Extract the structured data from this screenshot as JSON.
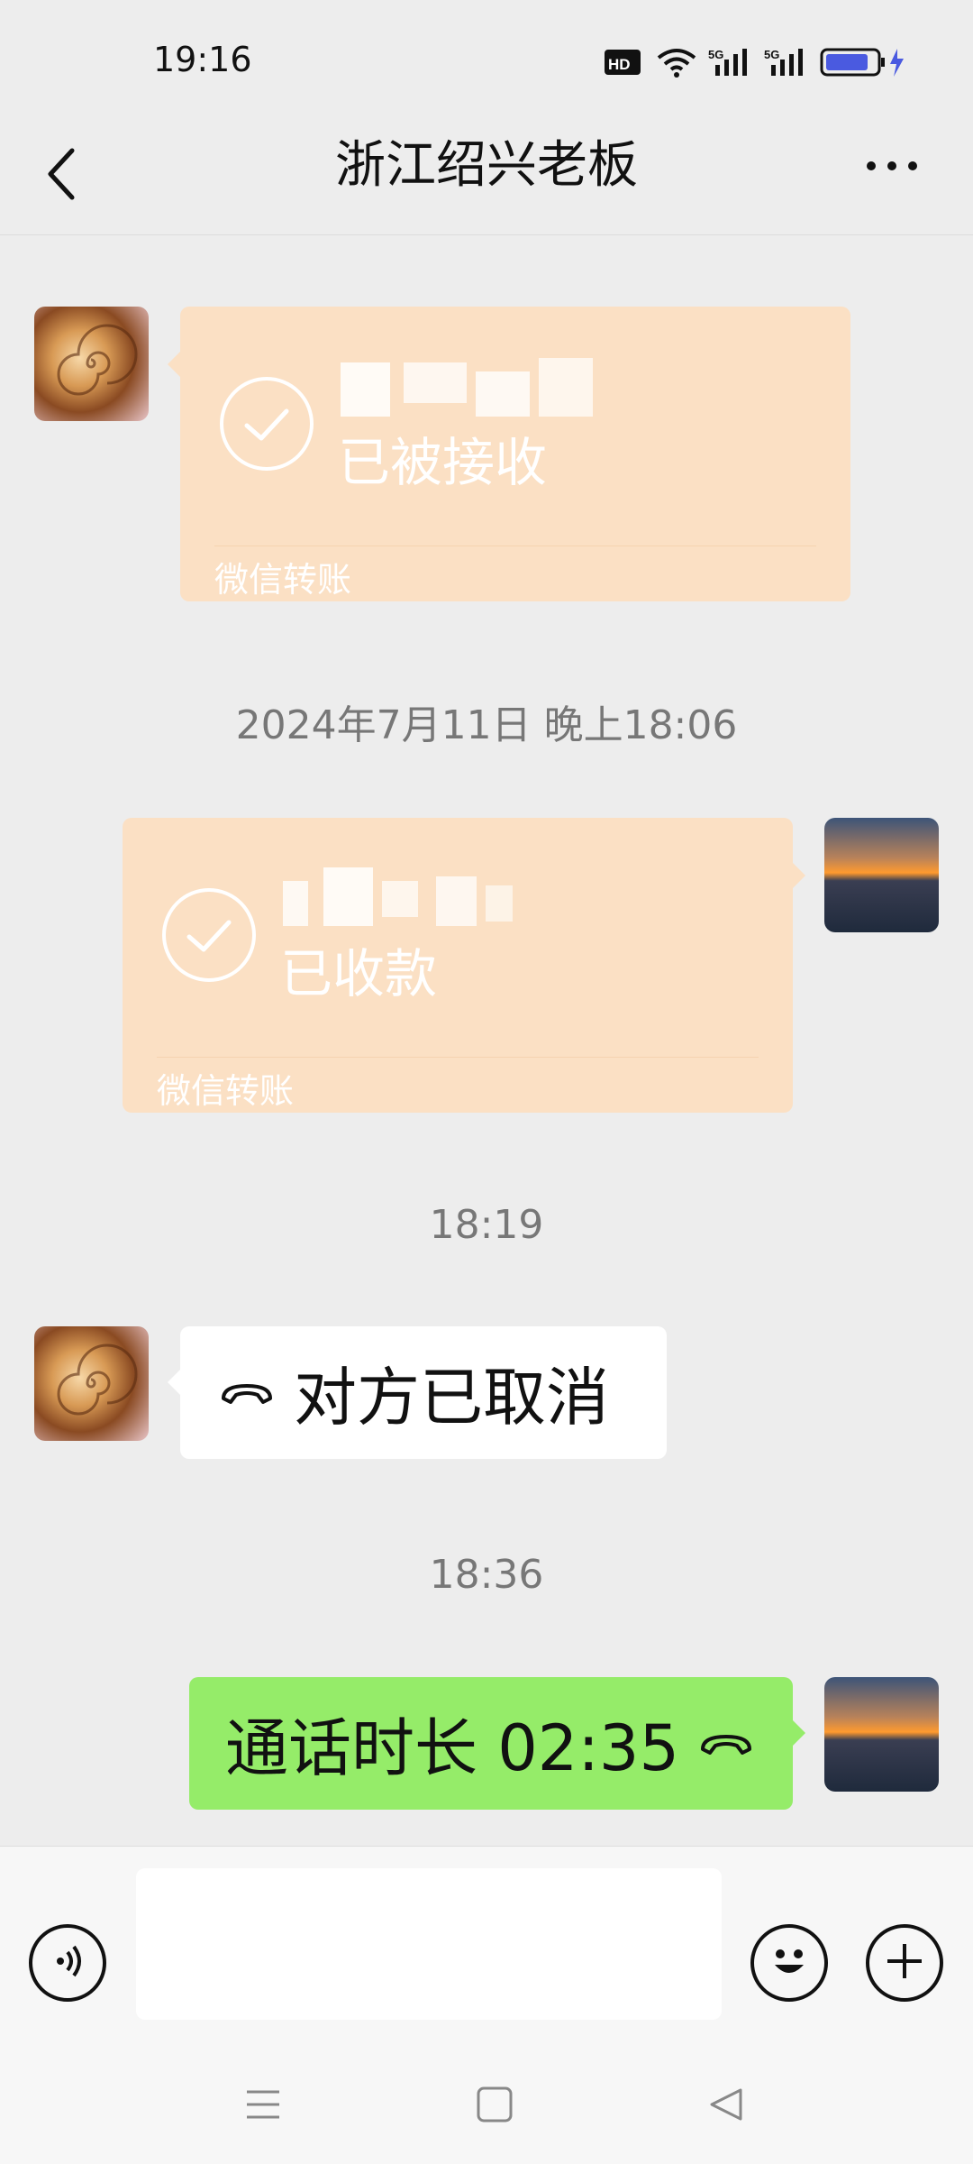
{
  "status_bar": {
    "time": "19:16",
    "icons": [
      "hd-icon",
      "wifi-icon",
      "5g-signal-icon",
      "5g-signal-icon",
      "battery-charging-icon"
    ],
    "hd_label": "HD",
    "net_label": "5G"
  },
  "header": {
    "title": "浙江绍兴老板",
    "back_icon": "chevron-left-icon",
    "more_icon": "more-horizontal-icon"
  },
  "messages": [
    {
      "type": "transfer",
      "side": "left",
      "status": "已被接收",
      "footer": "微信转账",
      "amount_blurred": true
    },
    {
      "type": "timestamp",
      "text": "2024年7月11日 晚上18:06"
    },
    {
      "type": "transfer",
      "side": "right",
      "status": "已收款",
      "footer": "微信转账",
      "amount_blurred": true
    },
    {
      "type": "timestamp",
      "text": "18:19"
    },
    {
      "type": "call",
      "side": "left",
      "text": "对方已取消",
      "icon": "phone-hangup-icon"
    },
    {
      "type": "timestamp",
      "text": "18:36"
    },
    {
      "type": "call",
      "side": "right",
      "text": "通话时长 02:35",
      "icon": "phone-hangup-icon"
    }
  ],
  "input_bar": {
    "voice_icon": "voice-icon",
    "input_value": "",
    "emoji_icon": "emoji-icon",
    "plus_icon": "plus-icon"
  },
  "nav_bar": {
    "icons": [
      "menu-icon",
      "home-icon",
      "back-triangle-icon"
    ]
  },
  "colors": {
    "background": "#ededed",
    "transfer_card": "#fbe0c4",
    "sent_bubble": "#95ec69",
    "received_bubble": "#ffffff",
    "battery": "#4a5ae0"
  }
}
